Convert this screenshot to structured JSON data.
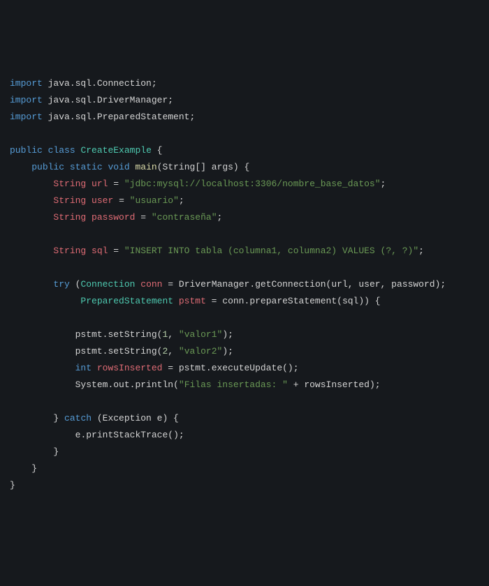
{
  "code": {
    "l1": {
      "import": "import",
      "pkg": "java.sql.Connection",
      "semi": ";"
    },
    "l2": {
      "import": "import",
      "pkg": "java.sql.DriverManager",
      "semi": ";"
    },
    "l3": {
      "import": "import",
      "pkg": "java.sql.PreparedStatement",
      "semi": ";"
    },
    "l5": {
      "public": "public",
      "class": "class",
      "name": "CreateExample",
      "brace": " {"
    },
    "l6": {
      "public": "public",
      "static": "static",
      "void": "void",
      "main": "main",
      "sig": "(String[] args) {"
    },
    "l7": {
      "type": "String",
      "var": "url",
      "eq": " = ",
      "val": "\"jdbc:mysql://localhost:3306/nombre_base_datos\"",
      "semi": ";"
    },
    "l8": {
      "type": "String",
      "var": "user",
      "eq": " = ",
      "val": "\"usuario\"",
      "semi": ";"
    },
    "l9": {
      "type": "String",
      "var": "password",
      "eq": " = ",
      "val": "\"contraseña\"",
      "semi": ";"
    },
    "l11": {
      "type": "String",
      "var": "sql",
      "eq": " = ",
      "val": "\"INSERT INTO tabla (columna1, columna2) VALUES (?, ?)\"",
      "semi": ";"
    },
    "l13": {
      "try": "try",
      "open": " (",
      "conn_t": "Connection",
      "conn_v": "conn",
      "eq": " = ",
      "dm": "DriverManager",
      "dot": ".",
      "gc": "getConnection",
      "args": "(url, user, password);"
    },
    "l14": {
      "ps_t": "PreparedStatement",
      "ps_v": "pstmt",
      "eq": " = ",
      "conn": "conn",
      "dot": ".",
      "m": "prepareStatement",
      "args": "(sql)) {"
    },
    "l16": {
      "obj": "pstmt",
      "dot": ".",
      "m": "setString",
      "open": "(",
      "n": "1",
      "c": ", ",
      "s": "\"valor1\"",
      "close": ");"
    },
    "l17": {
      "obj": "pstmt",
      "dot": ".",
      "m": "setString",
      "open": "(",
      "n": "2",
      "c": ", ",
      "s": "\"valor2\"",
      "close": ");"
    },
    "l18": {
      "int": "int",
      "var": "rowsInserted",
      "eq": " = ",
      "obj": "pstmt",
      "dot": ".",
      "m": "executeUpdate",
      "args": "();"
    },
    "l19": {
      "sys": "System",
      "d1": ".",
      "out": "out",
      "d2": ".",
      "m": "println",
      "open": "(",
      "s": "\"Filas insertadas: \"",
      "plus": " + rowsInserted);"
    },
    "l21": {
      "close": "}",
      "catch": " catch ",
      "sig": "(Exception e) {"
    },
    "l22": {
      "e": "e",
      "dot": ".",
      "m": "printStackTrace",
      "args": "();"
    },
    "l23": {
      "close": "}"
    },
    "l24": {
      "close": "}"
    },
    "l25": {
      "close": "}"
    }
  }
}
